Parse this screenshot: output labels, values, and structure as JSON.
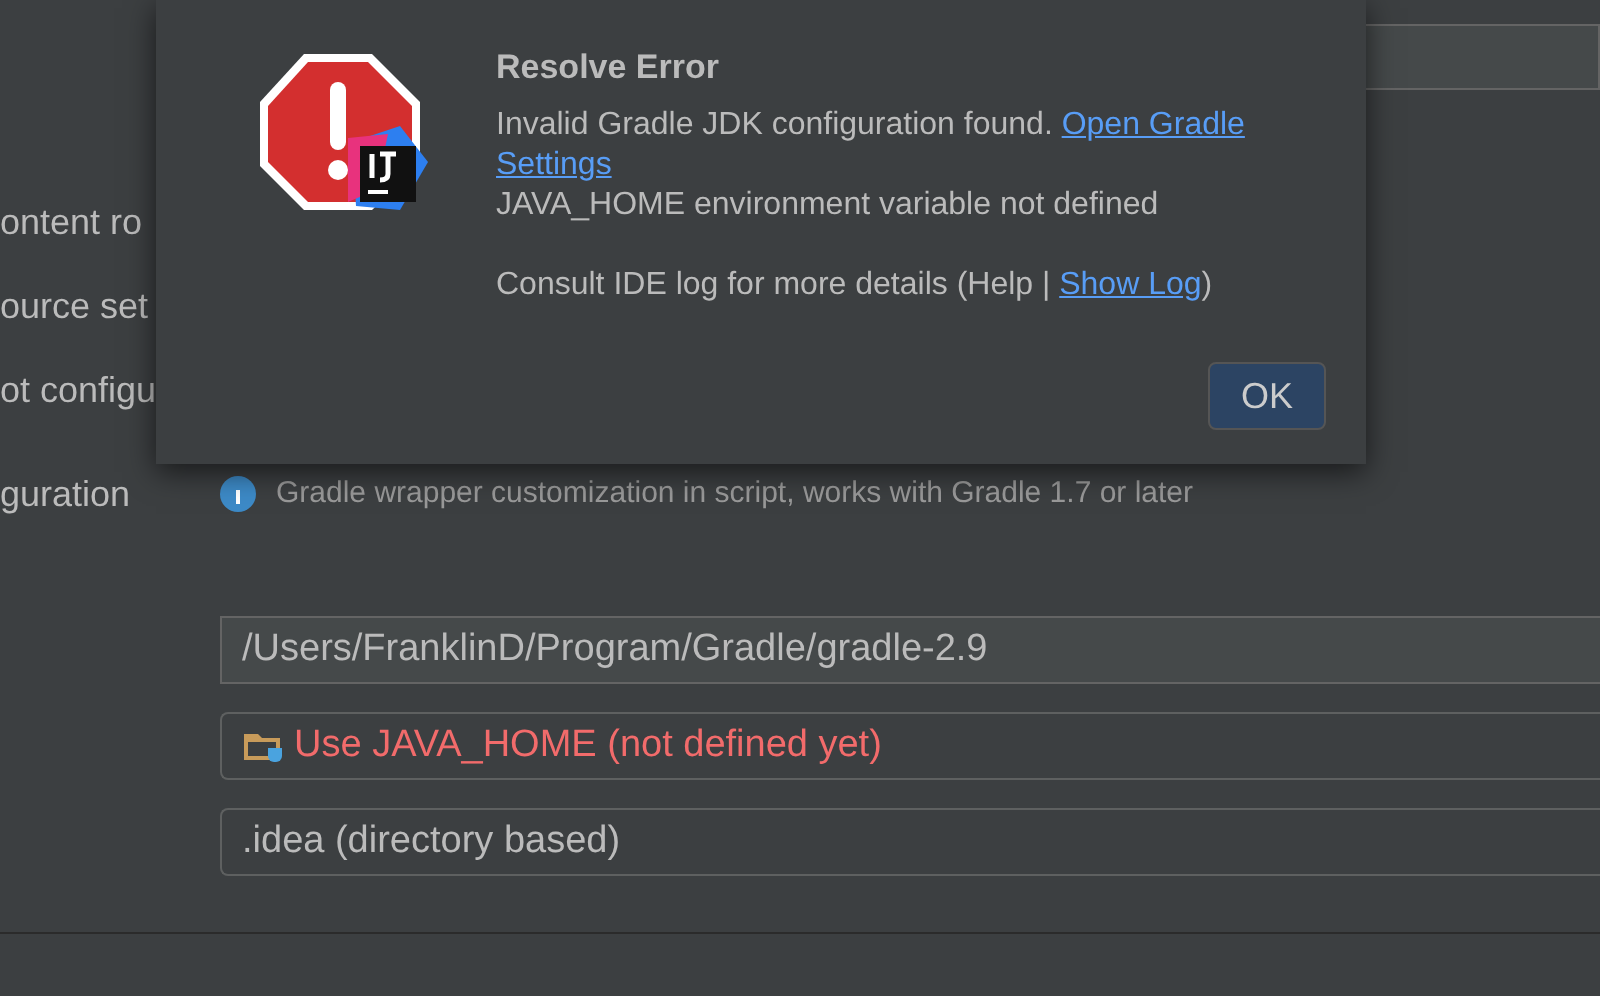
{
  "background": {
    "options": [
      {
        "label": "ontent ro"
      },
      {
        "label": "ource set"
      },
      {
        "label": "ot configu"
      }
    ],
    "configuration_label": "guration",
    "info_text": "Gradle wrapper customization in script, works with Gradle 1.7 or later",
    "fields": [
      {
        "kind": "path",
        "value": "/Users/FranklinD/Program/Gradle/gradle-2.9",
        "error": false
      },
      {
        "kind": "jvm",
        "value": "Use JAVA_HOME (not defined yet)",
        "error": true
      },
      {
        "kind": "plain",
        "value": ".idea (directory based)",
        "error": false
      }
    ]
  },
  "dialog": {
    "title": "Resolve Error",
    "message": [
      {
        "text": "Invalid Gradle JDK configuration found. ",
        "link_lines": [
          "Open Gradle",
          "Settings"
        ]
      },
      {
        "text": "JAVA_HOME environment variable not defined"
      }
    ],
    "log_text": "Consult IDE log for more details (Help | ",
    "log_link": "Show Log",
    "log_end": ")",
    "ok_button": "OK"
  }
}
